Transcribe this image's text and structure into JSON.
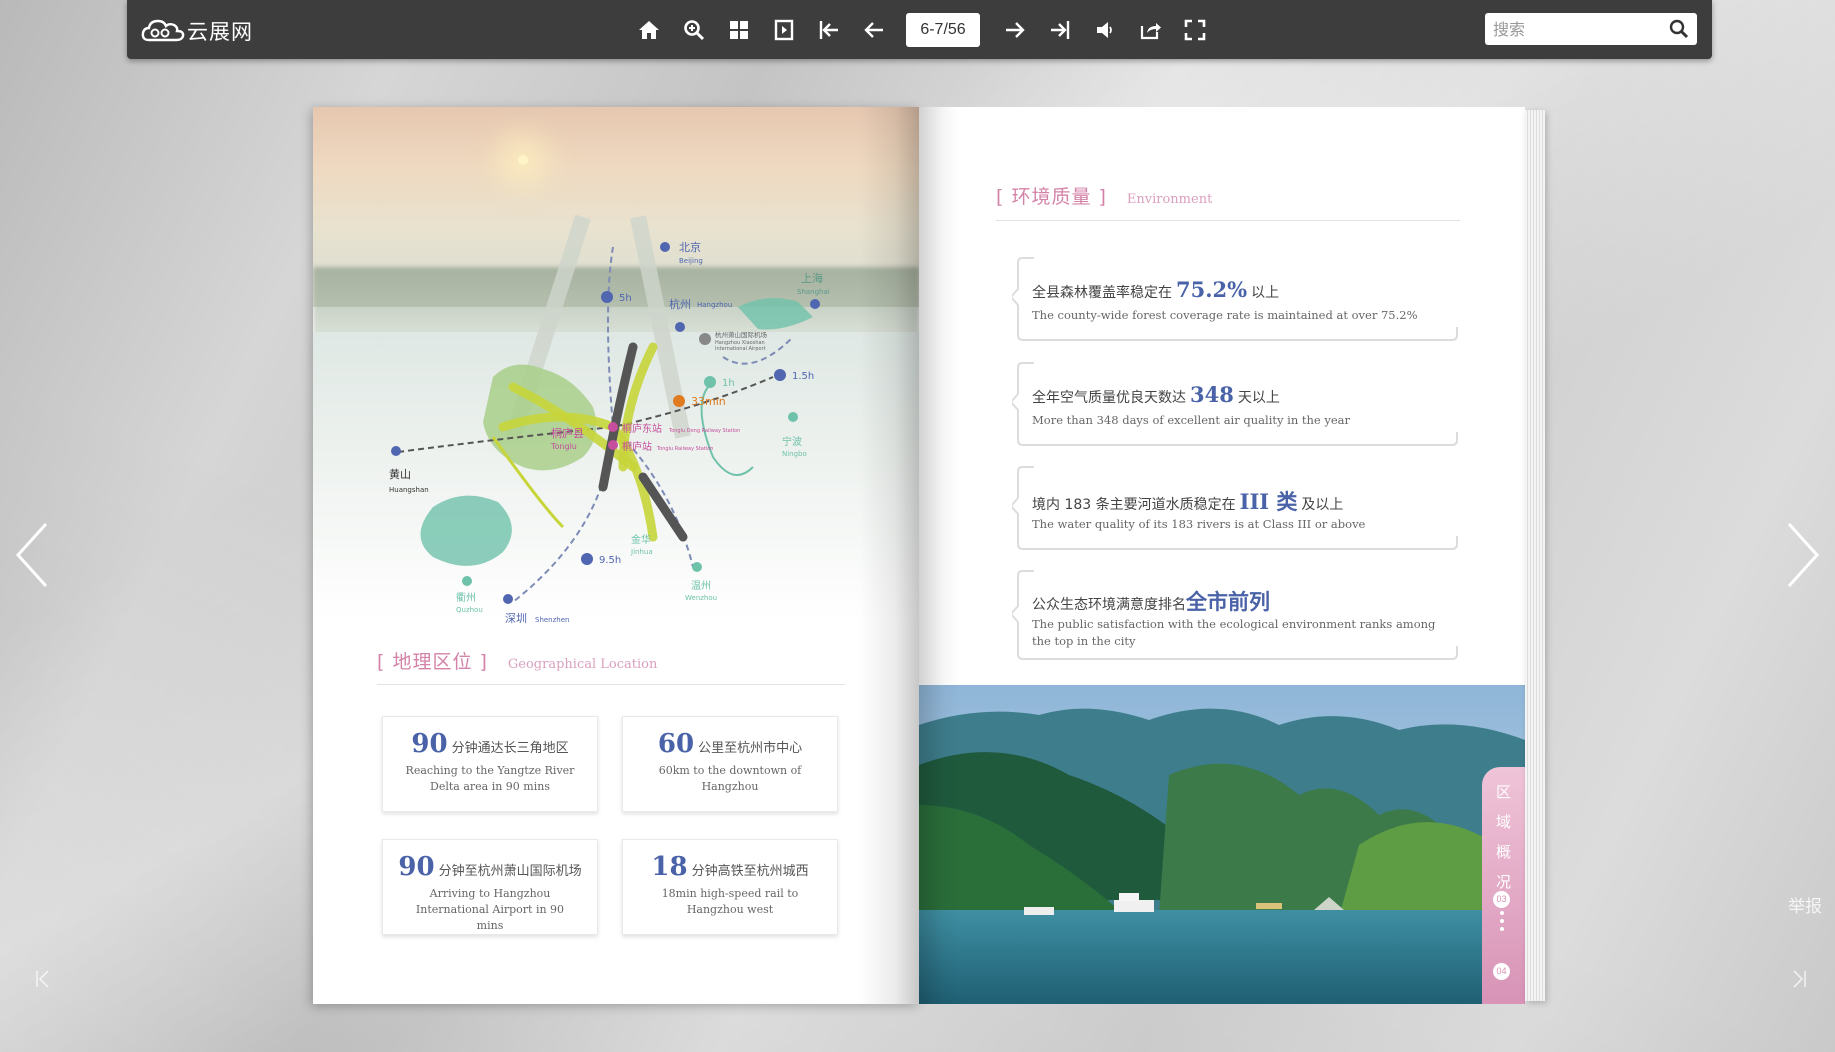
{
  "toolbar": {
    "logo_text": "云展网",
    "page_indicator": "6-7/56",
    "search_placeholder": "搜索",
    "tools": [
      "home-icon",
      "zoom-in-icon",
      "thumbnails-icon",
      "single-page-icon",
      "first-page-icon",
      "prev-page-icon",
      "next-page-icon",
      "last-page-icon",
      "sound-icon",
      "share-icon",
      "fullscreen-icon"
    ]
  },
  "report_label": "举报",
  "left_page": {
    "map": {
      "cities": [
        {
          "zh": "北京",
          "en": "Beijing"
        },
        {
          "zh": "上海",
          "en": "Shanghai"
        },
        {
          "zh": "杭州",
          "en": "Hangzhou"
        },
        {
          "zh": "黄山",
          "en": "Huangshan"
        },
        {
          "zh": "宁波",
          "en": "Ningbo"
        },
        {
          "zh": "金华",
          "en": "Jinhua"
        },
        {
          "zh": "衢州",
          "en": "Quzhou"
        },
        {
          "zh": "温州",
          "en": "Wenzhou"
        },
        {
          "zh": "深圳",
          "en": "Shenzhen"
        },
        {
          "zh": "桐庐县",
          "en": "Tonglu"
        }
      ],
      "stations": [
        {
          "zh": "桐庐东站",
          "en": "Tonglu Dong Railway Station"
        },
        {
          "zh": "桐庐站",
          "en": "Tonglu Railway Station"
        },
        {
          "zh": "杭州萧山国际机场",
          "en": "Hangzhou Xiaoshan International Airport"
        }
      ],
      "times": [
        "5h",
        "1h",
        "1.5h",
        "33min",
        "9.5h"
      ]
    },
    "section": {
      "zh": "[ 地理区位 ]",
      "en": "Geographical Location"
    },
    "cards": [
      {
        "num": "90",
        "label": "分钟通达长三角地区",
        "en": "Reaching to the Yangtze River Delta area in 90 mins"
      },
      {
        "num": "60",
        "label": "公里至杭州市中心",
        "en": "60km to the downtown of Hangzhou"
      },
      {
        "num": "90",
        "label": "分钟至杭州萧山国际机场",
        "en": "Arriving to Hangzhou International Airport in 90 mins"
      },
      {
        "num": "18",
        "label": "分钟高铁至杭州城西",
        "en": "18min high-speed rail to Hangzhou west"
      }
    ]
  },
  "right_page": {
    "section": {
      "zh": "[ 环境质量 ]",
      "en": "Environment"
    },
    "items": [
      {
        "pre": "全县森林覆盖率稳定在",
        "big": "75.2%",
        "post": "以上",
        "en": "The county-wide forest coverage rate is maintained at over 75.2%"
      },
      {
        "pre": "全年空气质量优良天数达",
        "big": "348",
        "post": "天以上",
        "en": "More than 348 days of excellent air quality in the year"
      },
      {
        "pre": "境内 183 条主要河道水质稳定在",
        "big": "III 类",
        "post": "及以上",
        "en": "The water quality of its 183 rivers is at Class III or above"
      },
      {
        "pre": "公众生态环境满意度排名",
        "big": "全市前列",
        "post": "",
        "en": "The public satisfaction with the ecological environment ranks among the top in the city"
      }
    ],
    "tab": {
      "chars": [
        "区",
        "域",
        "概",
        "况"
      ],
      "num_top": "03",
      "num_bottom": "04"
    }
  }
}
